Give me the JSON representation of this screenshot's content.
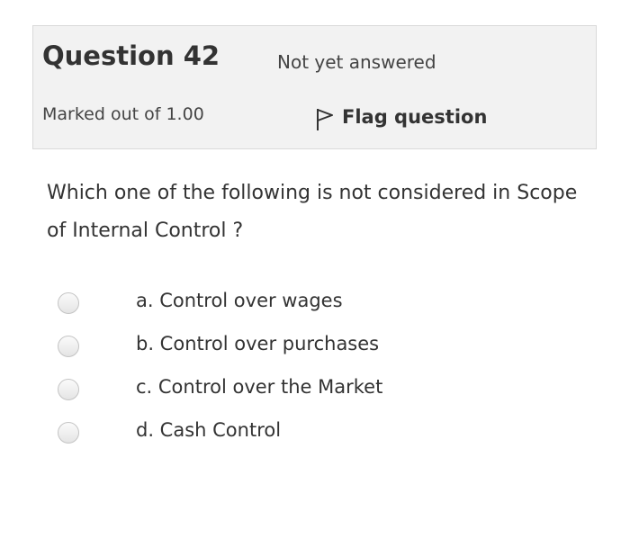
{
  "question": {
    "title_prefix": "Question",
    "number": "42",
    "state": "Not yet answered",
    "grade": "Marked out of 1.00",
    "flag_label": "Flag question",
    "text": "Which one of the following is not considered in Scope of Internal Control ?"
  },
  "answers": [
    {
      "label": "a. Control over wages",
      "selected": false
    },
    {
      "label": "b. Control over purchases",
      "selected": false
    },
    {
      "label": "c. Control over the Market",
      "selected": false
    },
    {
      "label": "d. Cash Control",
      "selected": false
    }
  ],
  "icons": {
    "flag": "flag-outline-icon",
    "radio": "radio-unchecked-icon"
  },
  "colors": {
    "info_background": "#f2f2f2",
    "info_border": "#d9d9d9",
    "text": "#333333"
  }
}
